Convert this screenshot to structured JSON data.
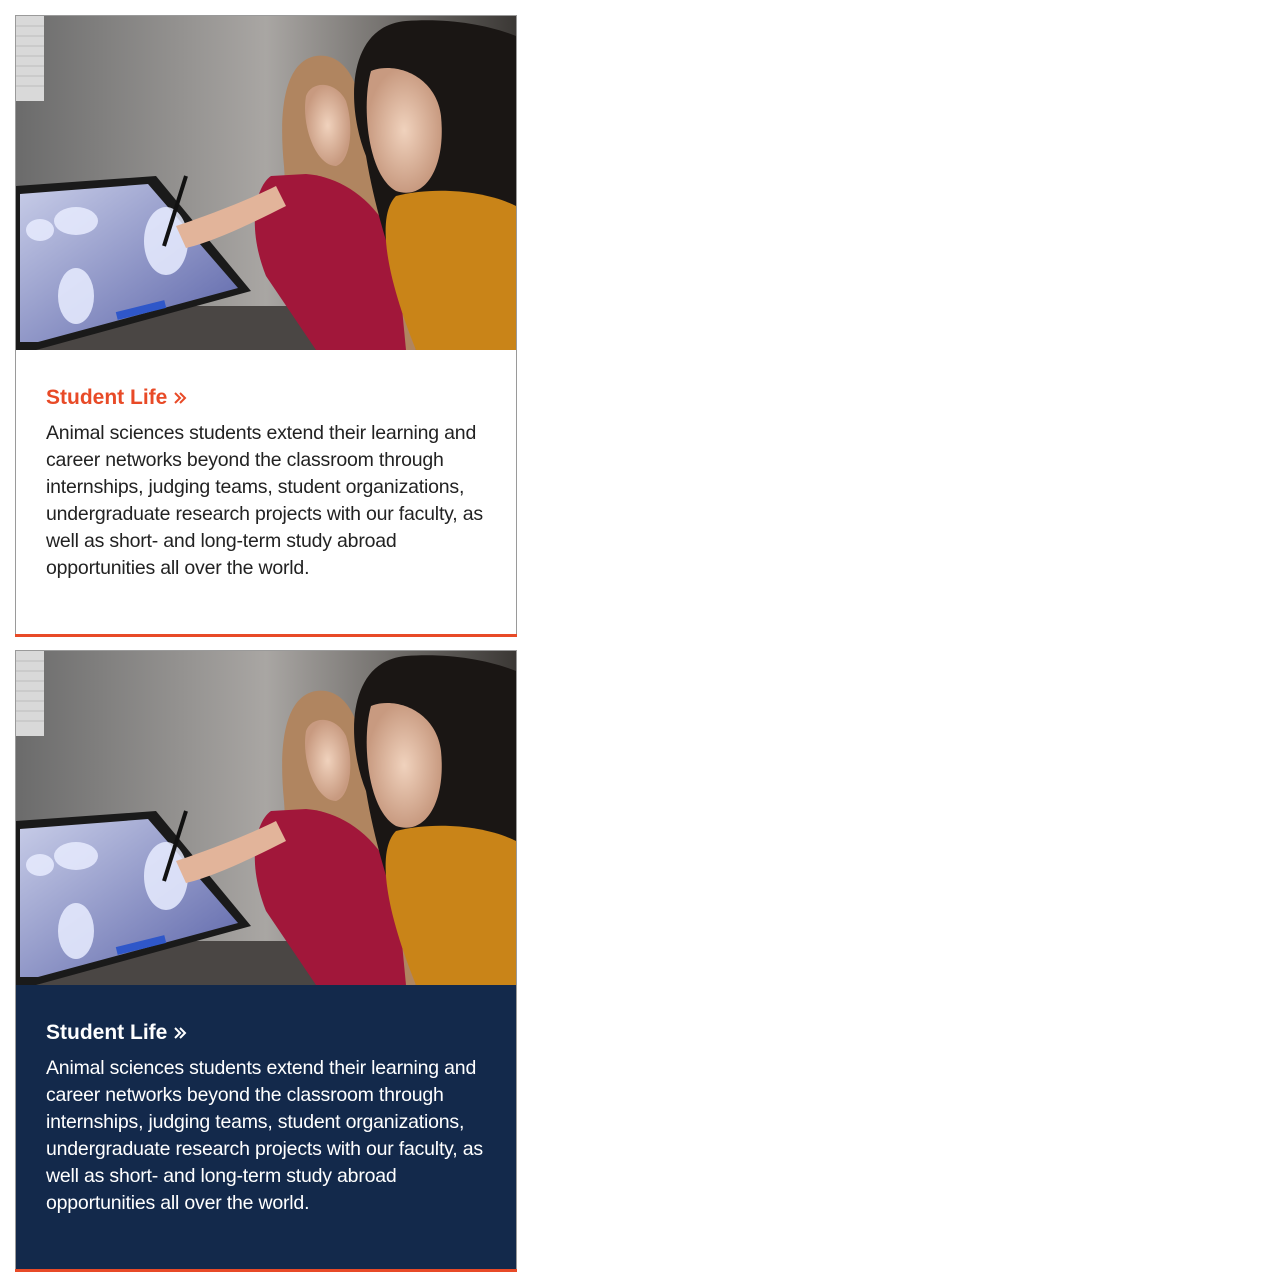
{
  "cards": [
    {
      "title": "Student Life",
      "body": "Animal sciences students extend their learning and career networks beyond the classroom through internships, judging teams, student organizations, undergraduate research projects with our faculty, as well as short- and long-term study abroad opportunities all over the world.",
      "theme": "light",
      "image_icon": "photo-students-at-touchscreen"
    },
    {
      "title": "Student Life",
      "body": "Animal sciences students extend their learning and career networks beyond the classroom through internships, judging teams, student organizations, undergraduate research projects with our faculty, as well as short- and long-term study abroad opportunities all over the world.",
      "theme": "dark",
      "image_icon": "photo-students-at-touchscreen"
    }
  ],
  "colors": {
    "accent": "#e84a27",
    "navy": "#13294b",
    "text_dark": "#222222",
    "text_light": "#ffffff"
  },
  "icons": {
    "title_chevron": "double-chevron-right-icon"
  }
}
